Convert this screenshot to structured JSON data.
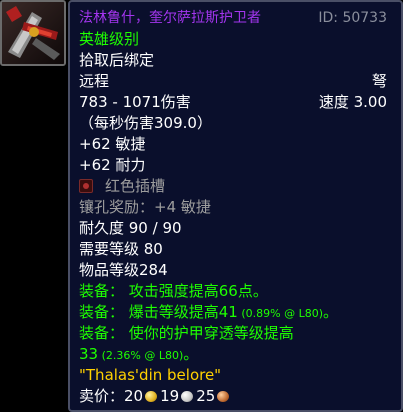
{
  "item": {
    "name": "法林鲁什，奎尔萨拉斯护卫者",
    "id_label": "ID: 50733",
    "quality": "英雄级别",
    "bind": "拾取后绑定",
    "slot": "远程",
    "type": "弩",
    "damage": "783 - 1071伤害",
    "speed": "速度 3.00",
    "dps": "（每秒伤害309.0）",
    "stat_agility": "+62 敏捷",
    "stat_stamina": "+62 耐力",
    "socket_label": "红色插槽",
    "socket_bonus": "镶孔奖励：+4 敏捷",
    "durability": "耐久度 90 / 90",
    "required_level": "需要等级 80",
    "item_level": "物品等级284",
    "equip_1": "装备： 攻击强度提高66点。",
    "equip_2_text": "装备： 爆击等级提高41",
    "equip_2_pct": " (0.89% @ L80)",
    "equip_2_end": "。",
    "equip_3": "装备： 使你的护甲穿透等级提高",
    "equip_3_value": "33",
    "equip_3_pct": " (2.36% @ L80)",
    "equip_3_end": "。",
    "flavor": "\"Thalas'din belore\"",
    "sell_label": "卖价：",
    "sell_gold": "20",
    "sell_silver": "19",
    "sell_copper": "25"
  },
  "colors": {
    "tooltip_bg": "#0a0f2c",
    "epic": "#a335ee",
    "green": "#1eff00",
    "grey": "#9d9d9d",
    "flavor": "#ffd100"
  },
  "icons": {
    "item_icon": "crossbow-item-icon",
    "socket": "red-socket-icon",
    "gold": "gold-coin-icon",
    "silver": "silver-coin-icon",
    "copper": "copper-coin-icon"
  }
}
